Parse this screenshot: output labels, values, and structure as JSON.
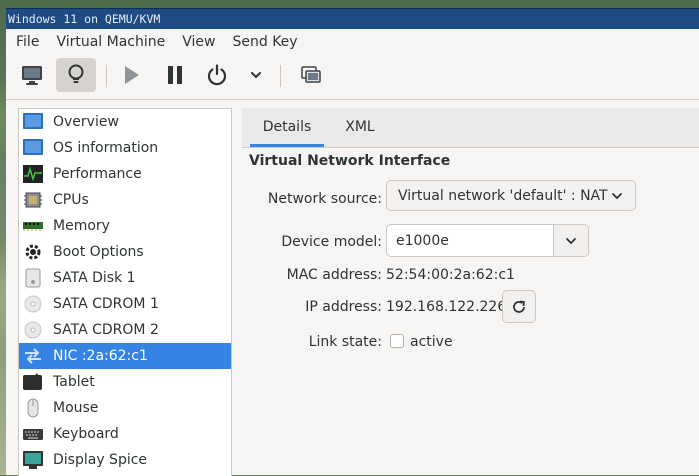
{
  "window": {
    "title": "Windows 11 on QEMU/KVM"
  },
  "menubar": [
    "File",
    "Virtual Machine",
    "View",
    "Send Key"
  ],
  "toolbar": {
    "icons": [
      "monitor-icon",
      "lightbulb-icon",
      "play-icon",
      "pause-icon",
      "power-icon",
      "chevron-down-icon",
      "screenshot-icon"
    ]
  },
  "sidebar": {
    "items": [
      {
        "label": "Overview",
        "icon": "overview-icon"
      },
      {
        "label": "OS information",
        "icon": "os-info-icon"
      },
      {
        "label": "Performance",
        "icon": "performance-icon"
      },
      {
        "label": "CPUs",
        "icon": "cpu-icon"
      },
      {
        "label": "Memory",
        "icon": "memory-icon"
      },
      {
        "label": "Boot Options",
        "icon": "gear-icon"
      },
      {
        "label": "SATA Disk 1",
        "icon": "disk-icon"
      },
      {
        "label": "SATA CDROM 1",
        "icon": "cdrom-icon"
      },
      {
        "label": "SATA CDROM 2",
        "icon": "cdrom-icon"
      },
      {
        "label": "NIC :2a:62:c1",
        "icon": "network-icon",
        "selected": true
      },
      {
        "label": "Tablet",
        "icon": "tablet-icon"
      },
      {
        "label": "Mouse",
        "icon": "mouse-icon"
      },
      {
        "label": "Keyboard",
        "icon": "keyboard-icon"
      },
      {
        "label": "Display Spice",
        "icon": "display-icon"
      }
    ]
  },
  "tabs": [
    "Details",
    "XML"
  ],
  "details": {
    "section_title": "Virtual Network Interface",
    "network_source_label": "Network source:",
    "network_source_value": "Virtual network 'default' : NAT",
    "device_model_label": "Device model:",
    "device_model_value": "e1000e",
    "mac_label": "MAC address:",
    "mac_value": "52:54:00:2a:62:c1",
    "ip_label": "IP address:",
    "ip_value": "192.168.122.226",
    "link_state_label": "Link state:",
    "link_state_option": "active",
    "link_state_checked": false
  },
  "colors": {
    "accent": "#3584e4",
    "titlebar": "#1f4b84"
  }
}
